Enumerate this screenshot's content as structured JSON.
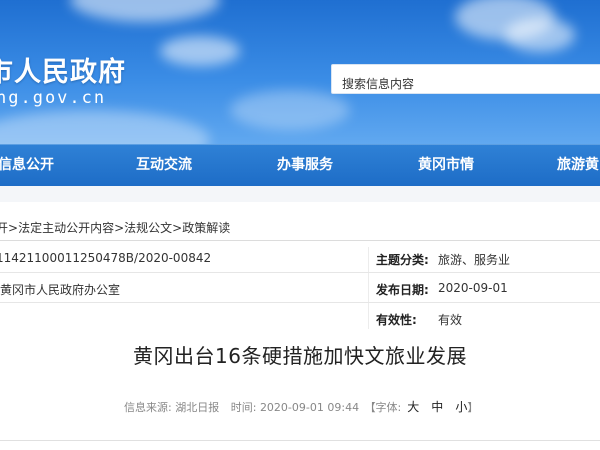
{
  "header": {
    "site_name": "市人民政府",
    "site_domain": "ng.gov.cn",
    "search": {
      "placeholder": "搜索信息内容"
    }
  },
  "nav": {
    "items": [
      {
        "label": "信息公开"
      },
      {
        "label": "互动交流"
      },
      {
        "label": "办事服务"
      },
      {
        "label": "黄冈市情"
      },
      {
        "label": "旅游黄"
      }
    ]
  },
  "breadcrumb": {
    "items": [
      "开",
      "法定主动公开内容",
      "法规公文",
      "政策解读"
    ],
    "separator": ">"
  },
  "meta": {
    "index_number": "11421100011250478B/2020-00842",
    "publisher": "黄冈市人民政府办公室",
    "topic_label": "主题分类:",
    "topic_value": "旅游、服务业",
    "date_label": "发布日期:",
    "date_value": "2020-09-01",
    "validity_label": "有效性:",
    "validity_value": "有效"
  },
  "article": {
    "title": "黄冈出台16条硬措施加快文旅业发展",
    "source_label": "信息来源:",
    "source_value": "湖北日报",
    "time_label": "时间:",
    "time_value": "2020-09-01 09:44",
    "font_label": "【字体:",
    "font_sizes": {
      "large": "大",
      "medium": "中",
      "small": "小"
    },
    "font_close": "】"
  },
  "colors": {
    "banner_top": "#1f6fd1",
    "nav_bg": "#2376cc",
    "text_main": "#222222",
    "text_muted": "#888888"
  }
}
